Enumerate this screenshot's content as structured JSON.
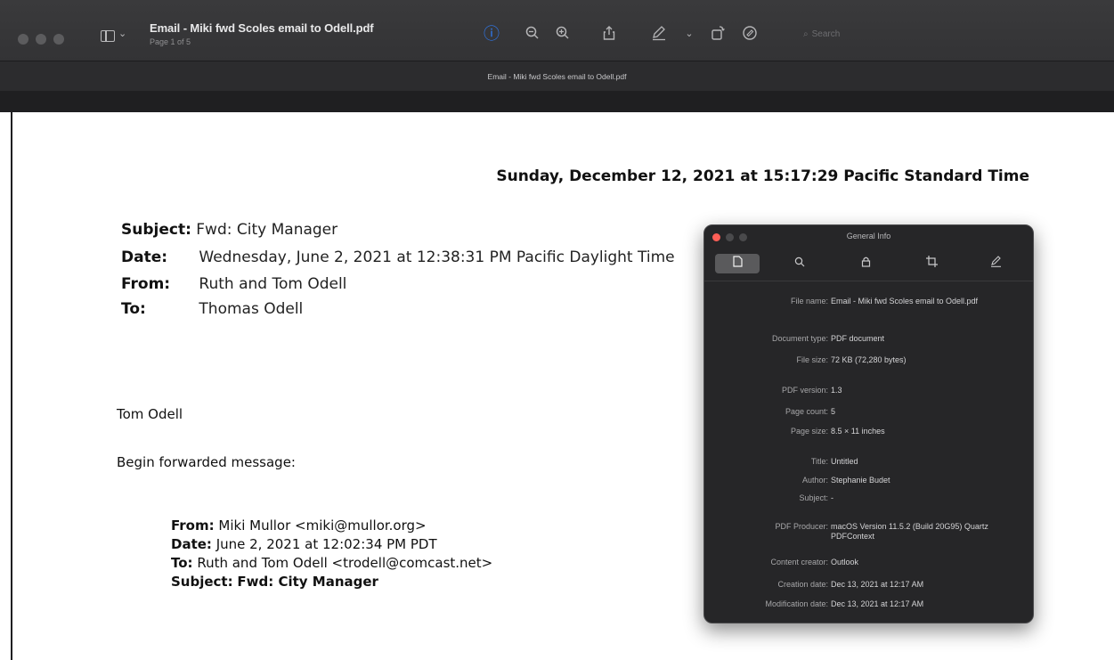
{
  "window": {
    "doc_title": "Email - Miki fwd Scoles email to Odell.pdf",
    "page_indicator": "Page 1 of 5",
    "tab_title": "Email - Miki fwd Scoles email to Odell.pdf",
    "search_placeholder": "Search",
    "toolbar_icons": [
      "info-icon",
      "zoom-out-icon",
      "zoom-in-icon",
      "share-icon",
      "markup-pen-icon",
      "chevron-down-icon",
      "rotate-icon",
      "annotate-icon"
    ]
  },
  "document": {
    "print_date": "Sunday, December 12, 2021 at 15:17:29 Pacific Standard Time",
    "subject_label": "Subject:",
    "subject_value": "Fwd: City Manager",
    "date_label": "Date:",
    "date_value": "Wednesday, June 2, 2021 at 12:38:31 PM Pacific Daylight Time",
    "from_label": "From:",
    "from_value": "Ruth and Tom Odell",
    "to_label": "To:",
    "to_value": "Thomas Odell",
    "signature": "Tom Odell",
    "begin_forwarded": "Begin forwarded message:",
    "fwd_from_label": "From:",
    "fwd_from_value": "Miki Mullor <miki@mullor.org>",
    "fwd_date_label": "Date:",
    "fwd_date_value": "June 2, 2021 at 12:02:34 PM PDT",
    "fwd_to_label": "To:",
    "fwd_to_value": "Ruth and Tom Odell <trodell@comcast.net>",
    "fwd_subject_label": "Subject:",
    "fwd_subject_value": "Fwd: City Manager"
  },
  "info_panel": {
    "title": "General Info",
    "tabs": [
      "general-info-tab",
      "search-info-tab",
      "security-tab",
      "crop-tab",
      "annotations-tab"
    ],
    "rows": [
      {
        "label": "File name:",
        "value": "Email - Miki fwd Scoles email to Odell.pdf"
      },
      {
        "label": "Document type:",
        "value": "PDF document"
      },
      {
        "label": "File size:",
        "value": "72 KB (72,280 bytes)"
      },
      {
        "label": "PDF version:",
        "value": "1.3"
      },
      {
        "label": "Page count:",
        "value": "5"
      },
      {
        "label": "Page size:",
        "value": "8.5 × 11 inches"
      },
      {
        "label": "Title:",
        "value": "Untitled"
      },
      {
        "label": "Author:",
        "value": "Stephanie Budet"
      },
      {
        "label": "Subject:",
        "value": "-"
      },
      {
        "label": "PDF Producer:",
        "value": "macOS Version 11.5.2 (Build 20G95) Quartz PDFContext"
      },
      {
        "label": "Content creator:",
        "value": "Outlook"
      },
      {
        "label": "Creation date:",
        "value": "Dec 13, 2021 at 12:17 AM"
      },
      {
        "label": "Modification date:",
        "value": "Dec 13, 2021 at 12:17 AM"
      }
    ]
  },
  "colors": {
    "toolbar_bg": "#333335",
    "accent": "#2f7cf6",
    "panel_bg": "#262628",
    "close_red": "#fe5f57"
  }
}
